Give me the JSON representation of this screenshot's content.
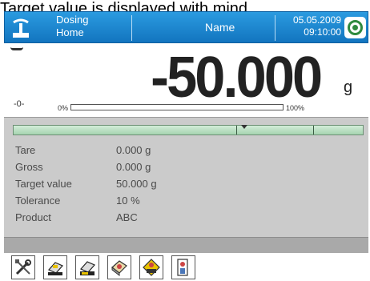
{
  "caption": "Target value is displayed with mind",
  "header": {
    "mode_line1": "Dosing",
    "mode_line2": "Home",
    "name": "Name",
    "date": "05.05.2009",
    "time": "09:10:00"
  },
  "reading": {
    "value": "-50.000",
    "unit": "g",
    "zero_indicator": "-0-",
    "bargraph_min": "0%",
    "bargraph_max": "100%",
    "bargraph_level": 0
  },
  "info": [
    {
      "label": "Tare",
      "value": "0.000  g"
    },
    {
      "label": "Gross",
      "value": "0.000  g"
    },
    {
      "label": "Target value",
      "value": "50.000  g"
    },
    {
      "label": "Tolerance",
      "value": "10 %"
    },
    {
      "label": "Product",
      "value": "ABC"
    }
  ],
  "toolbar": [
    "settings-icon",
    "tare-icon",
    "tare-set-icon",
    "product-database-icon",
    "target-cdb-icon",
    "operator-icon"
  ],
  "colors": {
    "header": "#1f86cf",
    "panel": "#cbcbcb",
    "checkweigh_bar": "#b9e0c1",
    "status_ok": "#2f8a3e"
  }
}
